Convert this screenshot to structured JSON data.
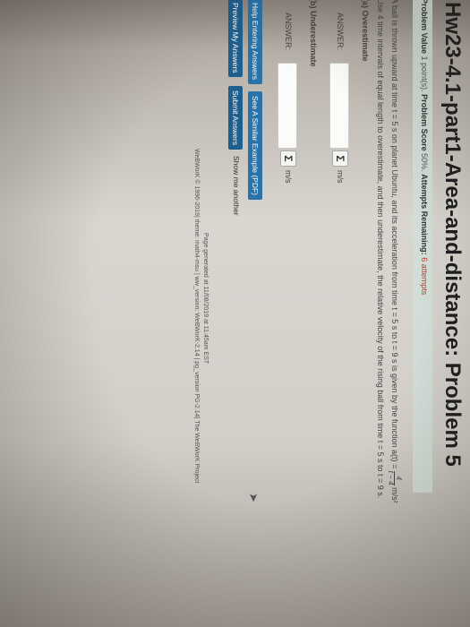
{
  "title": "Hw23-4.1-part1-Area-and-distance: Problem 5",
  "meta": {
    "value_label": "Problem Value",
    "value": "1 point(s).",
    "score_label": "Problem Score",
    "score": "50%.",
    "attempts_label": "Attempts Remaining:",
    "attempts": "6 attempts"
  },
  "problem": {
    "line1_a": "A ball is thrown upward at time",
    "line1_b": "t = 5 s on planet Ubuntu, and its acceleration from time t = 5 s to t = 9 s is given by the function a(t) = ",
    "frac_num": "4",
    "frac_den": "t − 4",
    "units": "m/s²",
    "line2": "Use 4 time intervals of equal length to overestimate, and then underestimate, the relative velocity of the rising ball from time t = 5 s to t = 9 s."
  },
  "part_a": {
    "label": "(a) Overestimate",
    "answer_label": "ANSWER:",
    "value": "",
    "unit": "m/s"
  },
  "part_b": {
    "label": "(b) Underestimate",
    "answer_label": "ANSWER:",
    "value": "",
    "unit": "m/s"
  },
  "buttons": {
    "help": "Help Entering Answers",
    "similar": "See A Similar Example (PDF)",
    "preview": "Preview My Answers",
    "submit": "Submit Answers",
    "another": "Show me another"
  },
  "footer": {
    "generated": "Page generated at 11/08/2019 at 11:45am EST",
    "credits": "WeBWorK © 1996-2019| theme: math4-msu | ww_version: WeBWorK-2.14 | pg_version PG-2.14| The WeBWorK Project"
  },
  "icons": {
    "sigma": "Σ"
  }
}
